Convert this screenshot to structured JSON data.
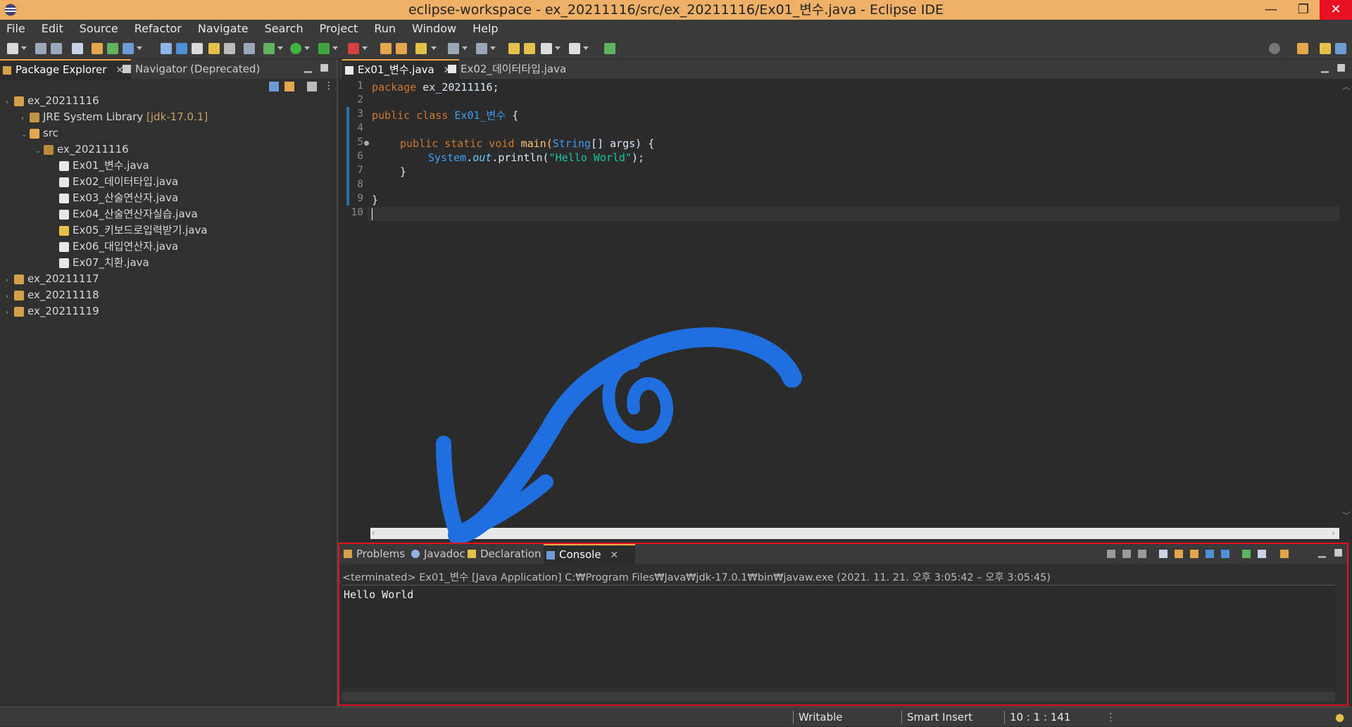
{
  "window": {
    "title": "eclipse-workspace - ex_20211116/src/ex_20211116/Ex01_변수.java - Eclipse IDE",
    "minimize": "—",
    "maximize": "❐",
    "close": "✕"
  },
  "menu": [
    "File",
    "Edit",
    "Source",
    "Refactor",
    "Navigate",
    "Search",
    "Project",
    "Run",
    "Window",
    "Help"
  ],
  "left_pane": {
    "tabs": [
      {
        "label": "Package Explorer",
        "close": "✕"
      },
      {
        "label": "Navigator (Deprecated)"
      }
    ],
    "tree": [
      {
        "label": "ex_20211116"
      },
      {
        "label": "JRE System Library",
        "suffix": "[jdk-17.0.1]"
      },
      {
        "label": "src"
      },
      {
        "label": "ex_20211116"
      },
      {
        "label": "Ex01_변수.java"
      },
      {
        "label": "Ex02_데이터타입.java"
      },
      {
        "label": "Ex03_산술연산자.java"
      },
      {
        "label": "Ex04_산술연산자실습.java"
      },
      {
        "label": "Ex05_키보드로입력받기.java"
      },
      {
        "label": "Ex06_대입연산자.java"
      },
      {
        "label": "Ex07_치환.java"
      },
      {
        "label": "ex_20211117"
      },
      {
        "label": "ex_20211118"
      },
      {
        "label": "ex_20211119"
      }
    ]
  },
  "editor": {
    "tabs": [
      {
        "label": "Ex01_변수.java",
        "close": "✕"
      },
      {
        "label": "Ex02_데이터타입.java"
      }
    ],
    "line_numbers": [
      "1",
      "2",
      "3",
      "4",
      "5",
      "6",
      "7",
      "8",
      "9",
      "10"
    ],
    "code": {
      "l1_kw": "package",
      "l1_rest": " ex_20211116;",
      "l3_kw": "public class ",
      "l3_cls": "Ex01_변수",
      "l3_rest": " {",
      "l5_kw": "public static void ",
      "l5_m": "main(",
      "l5_cls": "String",
      "l5_rest": "[] args) {",
      "l6_cls": "System",
      "l6_dot": ".",
      "l6_fld": "out",
      "l6_m": ".println(",
      "l6_str": "\"Hello World\"",
      "l6_end": ");",
      "l7": "}",
      "l9": "}"
    }
  },
  "console_pane": {
    "tabs": [
      {
        "label": "Problems"
      },
      {
        "label": "Javadoc"
      },
      {
        "label": "Declaration"
      },
      {
        "label": "Console",
        "close": "✕"
      }
    ],
    "header": "<terminated> Ex01_변수 [Java Application] C:₩Program Files₩Java₩jdk-17.0.1₩bin₩javaw.exe  (2021. 11. 21. 오후 3:05:42 – 오후 3:05:45)",
    "output": "Hello World"
  },
  "status": {
    "writable": "Writable",
    "insert_mode": "Smart Insert",
    "position": "10 : 1 : 141"
  }
}
